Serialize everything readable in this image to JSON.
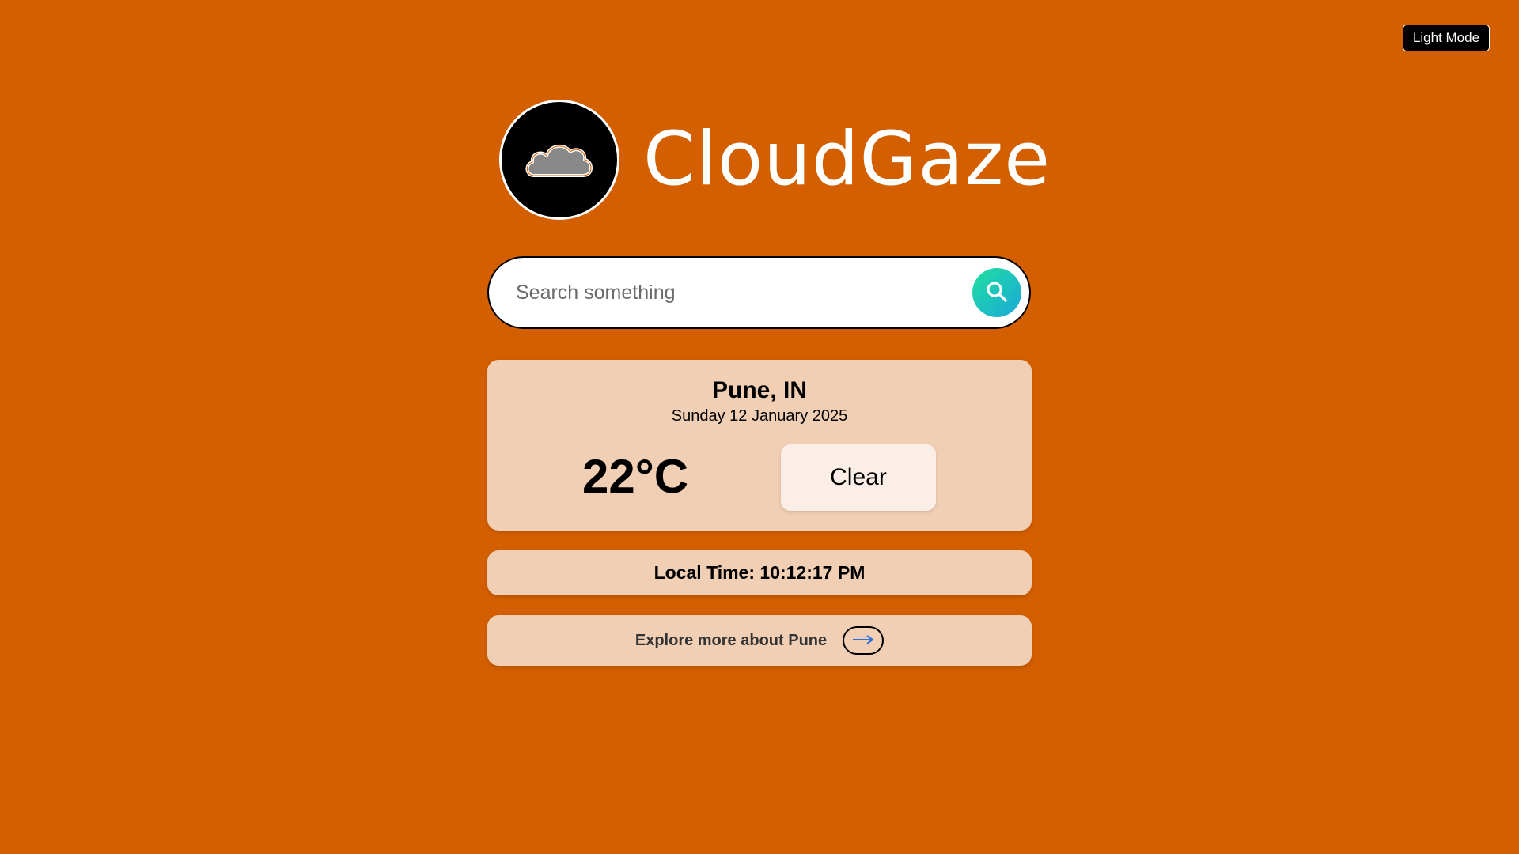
{
  "header": {
    "mode_toggle_label": "Light Mode"
  },
  "brand": {
    "logo_icon": "cloud-icon",
    "name": "CloudGaze"
  },
  "search": {
    "placeholder": "Search something",
    "value": "",
    "button_icon": "search-icon"
  },
  "weather": {
    "city": "Pune, IN",
    "date": "Sunday 12 January 2025",
    "temperature": "22°C",
    "condition": "Clear"
  },
  "local_time": {
    "text": "Local Time: 10:12:17 PM"
  },
  "explore": {
    "label": "Explore more about Pune",
    "arrow_icon": "arrow-right-icon"
  },
  "colors": {
    "background": "#d35f00",
    "card": "#f1cfb4",
    "condition_badge": "#fbeee6",
    "search_button_gradient_start": "#1fe0a0",
    "search_button_gradient_end": "#1aa8d8",
    "arrow": "#2a6fdb"
  }
}
